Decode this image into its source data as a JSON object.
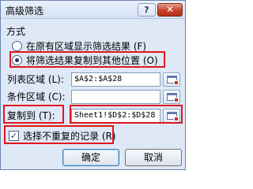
{
  "window": {
    "title": "高级筛选",
    "help_label": "?",
    "close_label": "✕"
  },
  "method": {
    "group_label": "方式",
    "options": [
      {
        "label": "在原有区域显示筛选结果 (F)",
        "checked": false
      },
      {
        "label": "将筛选结果复制到其他位置 (O)",
        "checked": true
      }
    ]
  },
  "fields": {
    "list_range": {
      "label": "列表区域 (L):",
      "value": "$A$2:$A$28"
    },
    "criteria_range": {
      "label": "条件区域 (C):",
      "value": ""
    },
    "copy_to": {
      "label": "复制到 (T):",
      "value": "Sheet1!$D$2:$D$28"
    }
  },
  "unique": {
    "label": "选择不重复的记录 (R)",
    "checked": true,
    "check_mark": "✓"
  },
  "buttons": {
    "ok_label": "确定",
    "cancel_label": "取消"
  },
  "colors": {
    "dialog_bg": "#dfe8f6",
    "highlight": "#e0161c",
    "close_red": "#c7412a"
  },
  "icons": [
    "help-icon",
    "close-icon",
    "range-picker-icon"
  ]
}
